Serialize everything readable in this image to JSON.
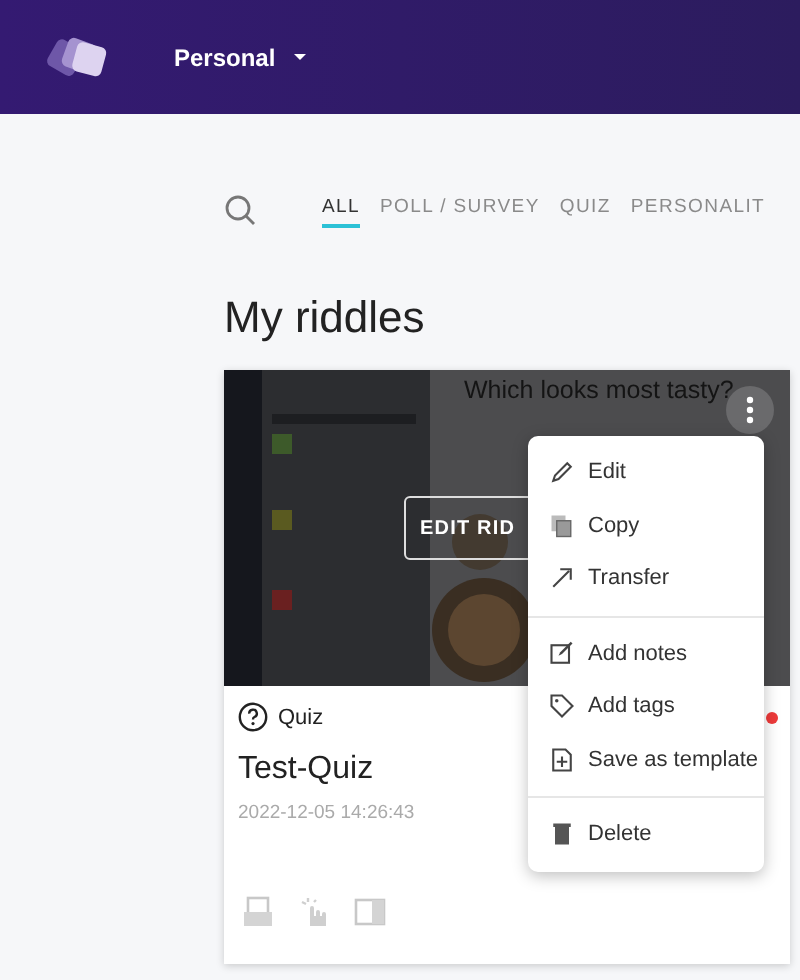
{
  "header": {
    "workspace": "Personal"
  },
  "filter_tabs": [
    {
      "label": "ALL",
      "selected": true
    },
    {
      "label": "POLL / SURVEY",
      "selected": false
    },
    {
      "label": "QUIZ",
      "selected": false
    },
    {
      "label": "PERSONALIT",
      "selected": false
    }
  ],
  "page_title": "My riddles",
  "riddle_card": {
    "thumbnail": {
      "kind": "picture",
      "question": "Which looks most tasty?",
      "overlay_button": "EDIT RID"
    },
    "type": "Quiz",
    "title": "Test-Quiz",
    "created": "2022-12-05 14:26:43",
    "notification_dot": true
  },
  "context_menu": [
    [
      {
        "kind": "edit",
        "label": "Edit"
      },
      {
        "kind": "copy",
        "label": "Copy"
      },
      {
        "kind": "transfer",
        "label": "Transfer"
      }
    ],
    [
      {
        "kind": "notes",
        "label": "Add notes"
      },
      {
        "kind": "tags",
        "label": "Add tags"
      },
      {
        "kind": "template",
        "label": "Save as template"
      }
    ],
    [
      {
        "kind": "delete",
        "label": "Delete"
      }
    ]
  ]
}
